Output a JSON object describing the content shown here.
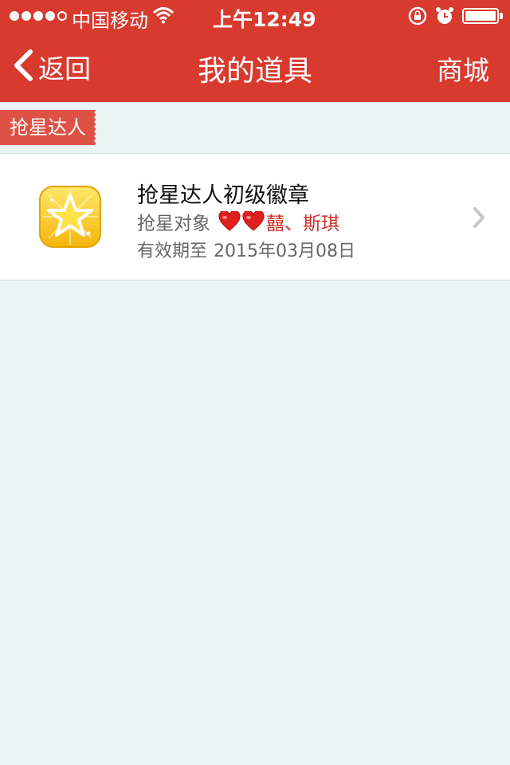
{
  "status_bar": {
    "signal_dots": 5,
    "signal_filled": 4,
    "carrier": "中国移动",
    "time": "上午12:49",
    "wifi_icon": "wifi-icon",
    "lock_icon": "rotation-lock-icon",
    "alarm_icon": "alarm-icon",
    "battery_level": 1.0
  },
  "nav": {
    "back_label": "返回",
    "title": "我的道具",
    "right_label": "商城"
  },
  "section": {
    "tag": "抢星达人"
  },
  "items": [
    {
      "title": "抢星达人初级徽章",
      "target_label": "抢星对象",
      "target_names": "囍、斯琪",
      "hearts": 2,
      "expiry_label": "有效期至",
      "expiry_date": "2015年03月08日",
      "icon": "gold-star-badge-icon"
    }
  ],
  "colors": {
    "header": "#d83a2e",
    "tag": "#de5246",
    "accent_text": "#c7332a",
    "background": "#eaf3f3"
  }
}
